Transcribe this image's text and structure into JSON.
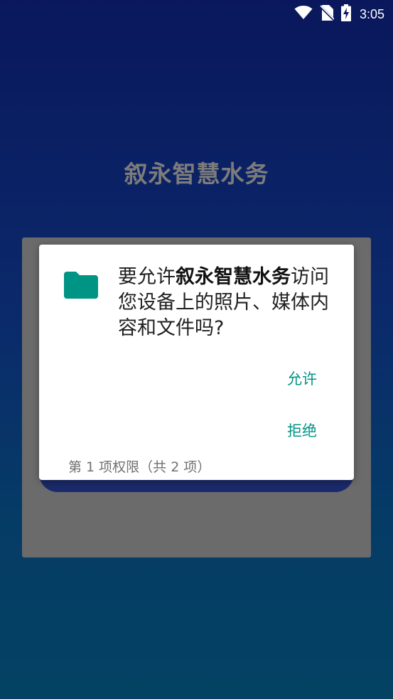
{
  "status_bar": {
    "time": "3:05",
    "icons": [
      "wifi-icon",
      "no-sim-icon",
      "battery-charging-icon"
    ]
  },
  "app": {
    "title": "叙永智慧水务"
  },
  "permission_dialog": {
    "icon": "folder-icon",
    "message_prefix": "要允许",
    "app_name": "叙永智慧水务",
    "message_suffix": "访问您设备上的照片、媒体内容和文件吗?",
    "allow_label": "允许",
    "deny_label": "拒绝",
    "counter": "第 1 项权限（共 2 项）"
  },
  "colors": {
    "accent": "#009485",
    "folder": "#009485",
    "scrim": "#6b6b6b",
    "title_text": "#7c7c7c"
  }
}
